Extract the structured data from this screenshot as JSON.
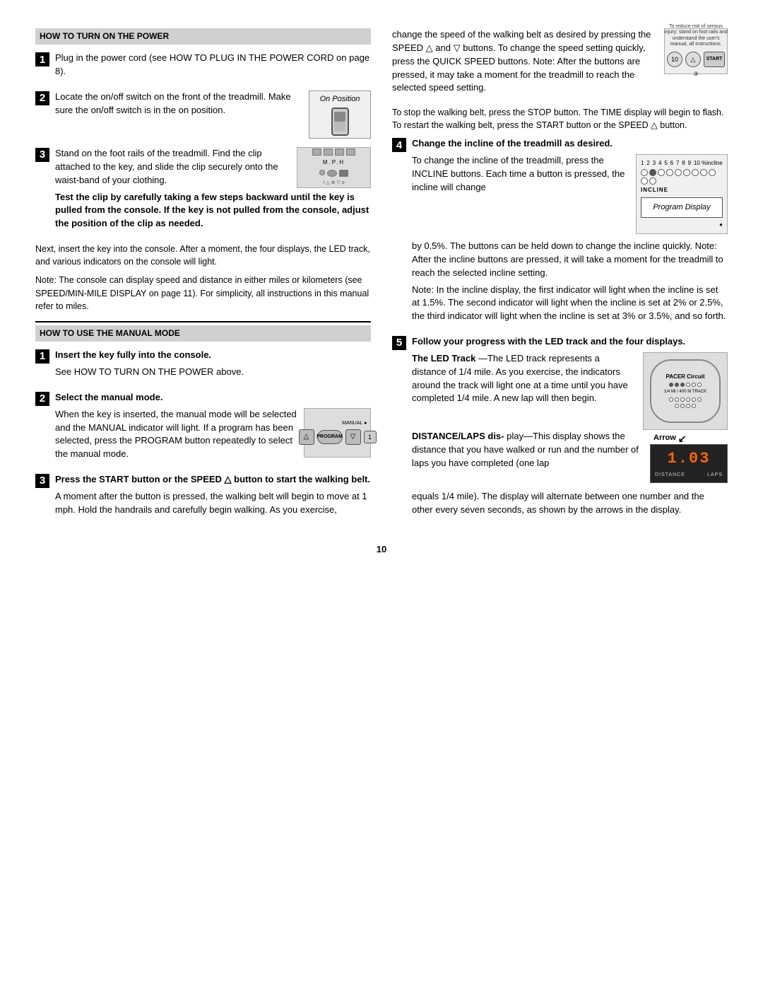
{
  "page": {
    "number": "10",
    "sections": {
      "how_to_turn_on": {
        "heading": "HOW TO TURN ON THE POWER",
        "steps": [
          {
            "num": "1",
            "text": "Plug in the power cord (see HOW TO PLUG IN THE POWER CORD on page 8)."
          },
          {
            "num": "2",
            "text_parts": [
              "Locate the on/off switch on the front of the treadmill. Make sure the on/off switch is in the on position."
            ],
            "image_label": "On Position"
          },
          {
            "num": "3",
            "text_parts": [
              "Stand on the foot rails of the treadmill. Find the clip attached to the key, and slide the clip securely onto the waist-band of your clothing."
            ],
            "bold_text": "Test the clip by carefully taking a few steps backward until the key is pulled from the console. If the key is not pulled from the console, adjust the position of the clip as needed."
          }
        ],
        "note1": "Next, insert the key into the console. After a moment, the four displays, the LED track, and various indicators on the console will light.",
        "note2": "Note: The console can display speed and distance in either miles or kilometers (see SPEED/MIN-MILE DISPLAY on page 11). For simplicity, all instructions in this manual refer to miles."
      },
      "how_to_use_manual": {
        "heading": "HOW TO USE THE MANUAL MODE",
        "steps": [
          {
            "num": "1",
            "heading": "Insert the key fully into the console.",
            "text": "See HOW TO TURN ON THE POWER above."
          },
          {
            "num": "2",
            "heading": "Select the manual mode.",
            "text_parts": [
              "When the key is inserted, the manual mode will be selected and the MANUAL indicator will light. If a program has been selected, press the PROGRAM button repeatedly to select the manual mode."
            ]
          },
          {
            "num": "3",
            "heading": "Press the START button or the SPEED △ button to start the walking belt.",
            "text": "A moment after the button is pressed, the walking belt will begin to move at 1 mph. Hold the handrails and carefully begin walking. As you exercise,"
          }
        ]
      },
      "right_col": {
        "speed_text_1": "change the speed of the walking belt as desired by pressing the SPEED △ and ▽ buttons. To change the speed setting quickly, press the QUICK SPEED buttons. Note: After the buttons are pressed, it may take a moment for the treadmill to reach the selected speed setting.",
        "speed_text_2": "To stop the walking belt, press the STOP button. The TIME display will begin to flash. To restart the walking belt, press the START button or the SPEED △ button.",
        "step4": {
          "num": "4",
          "heading": "Change the incline of the treadmill as desired.",
          "text_parts": [
            "To change the incline of the treadmill, press the INCLINE buttons. Each time a button is pressed, the incline will change",
            "by 0.5%. The buttons can be held down to change the incline quickly. Note: After the incline buttons are pressed, it will take a moment for the treadmill to reach the selected incline setting.",
            "Note: In the incline display, the first indicator will light when the incline is set at 1.5%. The second indicator will light when the incline is set at 2% or 2.5%, the third indicator will light when the incline is set at 3% or 3.5%, and so forth."
          ],
          "program_display_label": "Program Display"
        },
        "step5": {
          "num": "5",
          "heading": "Follow your progress with the LED track and the four displays.",
          "led_track": {
            "heading": "The LED Track",
            "text": "—The LED track represents a distance of 1/4 mile. As you exercise, the indicators around the track will light one at a time until you have completed 1/4 mile. A new lap will then begin."
          },
          "distance_laps": {
            "heading": "DISTANCE/LAPS dis-",
            "text_1": "play—This display shows the distance that you have walked or run and the number of laps you have completed (one lap",
            "text_2": "equals 1/4 mile). The display will alternate between one number and the other every seven seconds, as shown by the arrows in the display."
          },
          "display_value": "1.03",
          "arrow_label": "Arrow",
          "distance_label": "DISTANCE",
          "laps_label": "LAPS"
        }
      }
    }
  }
}
